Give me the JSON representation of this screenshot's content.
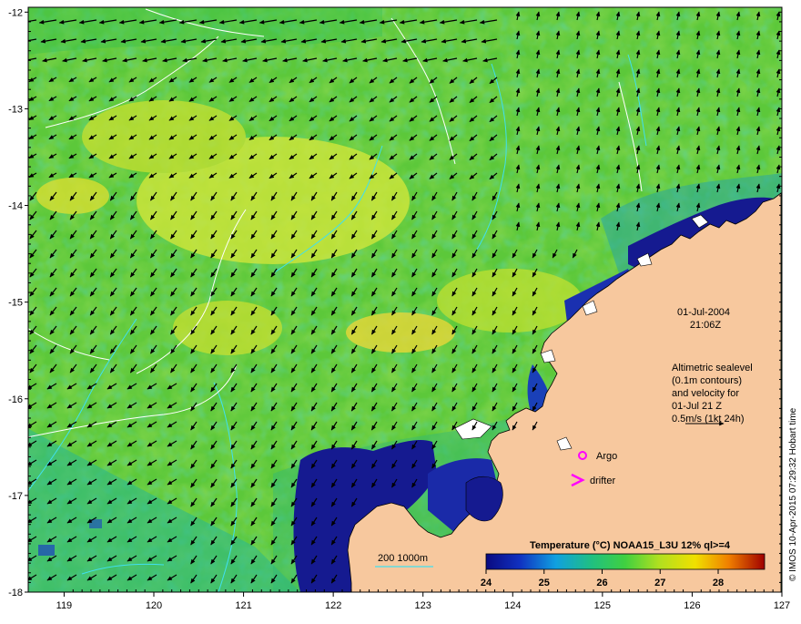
{
  "map": {
    "lon_ticks": [
      "119",
      "120",
      "121",
      "122",
      "123",
      "124",
      "125",
      "126",
      "127"
    ],
    "lat_ticks": [
      "-12",
      "-13",
      "-14",
      "-15",
      "-16",
      "-17",
      "-18"
    ],
    "lon_range": [
      118.6,
      127
    ],
    "lat_range": [
      -18,
      -11.95
    ]
  },
  "date": "01-Jul-2004",
  "time": "21:06Z",
  "legend_text": {
    "line1": "Altimetric sealevel",
    "line2": "(0.1m contours)",
    "line3": "and velocity for",
    "line4": "01-Jul 21 Z",
    "line5": "0.5m/s (1kt 24h)"
  },
  "markers": {
    "argo_label": "Argo",
    "drifter_label": "drifter"
  },
  "depth_legend": {
    "label": "200  1000m"
  },
  "colorbar": {
    "title": "Temperature (°C) NOAA15_L3U 12% ql>=4",
    "ticks": [
      "24",
      "25",
      "26",
      "27",
      "28"
    ],
    "range": [
      24,
      28.8
    ]
  },
  "credit": "© IMOS 10-Apr-2015 07:29:32 Hobart time",
  "colors": {
    "land": "#f7c89e",
    "cold": "#10107a",
    "mid": "#38c038",
    "warm": "#f0f030",
    "contour": "#ffffff",
    "isobath": "#40e0f0",
    "marker": "#ff00ff"
  }
}
